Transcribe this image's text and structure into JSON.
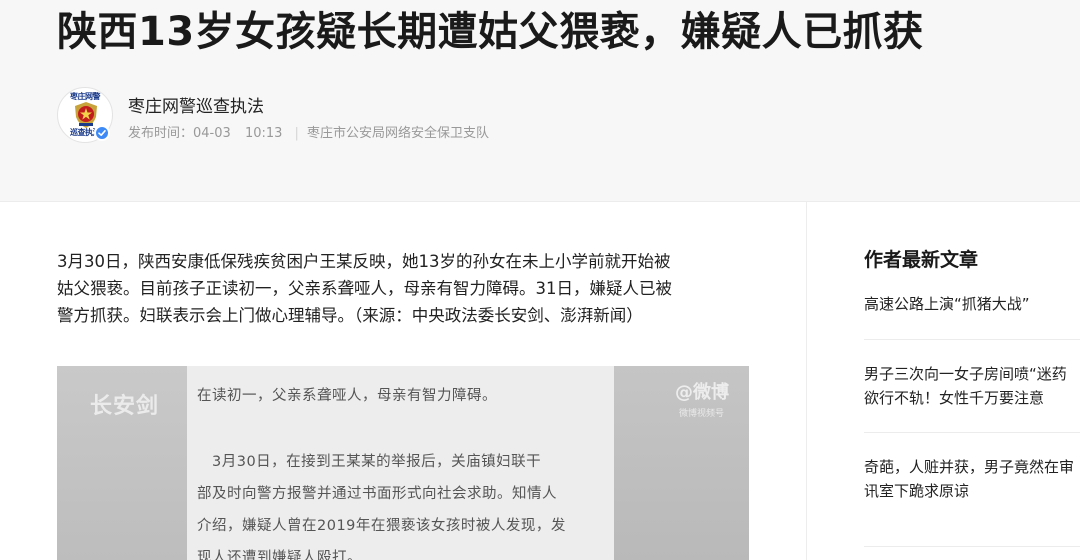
{
  "article": {
    "title": "陕西13岁女孩疑长期遭姑父猥亵，嫌疑人已抓获",
    "lead_lines": [
      "3月30日，陕西安康低保残疾贫困户王某反映，她13岁的孙女在未上小学前就开始被",
      "姑父猥亵。目前孩子正读初一，父亲系聋哑人，母亲有智力障碍。31日，嫌疑人已被",
      "警方抓获。妇联表示会上门做心理辅导。（来源：中央政法委长安剑、澎湃新闻）"
    ]
  },
  "author": {
    "name": "枣庄网警巡查执法",
    "avatar_top_text": "枣庄网警",
    "avatar_bottom_text": "巡查执法",
    "publish_label": "发布时间：",
    "publish_date": "04-03",
    "publish_time": "10:13",
    "organization": "枣庄市公安局网络安全保卫支队",
    "verified": true
  },
  "image": {
    "doc_lines": [
      "在读初一，父亲系聋哑人，母亲有智力障碍。",
      "",
      "　3月30日，在接到王某某的举报后，关庙镇妇联干",
      "部及时向警方报警并通过书面形式向社会求助。知情人",
      "介绍，嫌疑人曾在2019年在猥亵该女孩时被人发现，发",
      "现人还遭到嫌疑人殴打。"
    ],
    "watermark_left": "长安剑",
    "watermark_right": "@微博",
    "watermark_right_sub": "微博视频号"
  },
  "sidebar": {
    "title": "作者最新文章",
    "items": [
      {
        "lines": [
          "高速公路上演“抓猪大战”"
        ]
      },
      {
        "lines": [
          "男子三次向一女子房间喷“迷药",
          "欲行不轨！女性千万要注意"
        ]
      },
      {
        "lines": [
          "奇葩，人赃并获，男子竟然在审",
          "讯室下跪求原谅"
        ]
      }
    ]
  },
  "colors": {
    "header_bg": "#f7f7f7",
    "verified_badge": "#3d8af7",
    "meta_text": "#999999"
  }
}
